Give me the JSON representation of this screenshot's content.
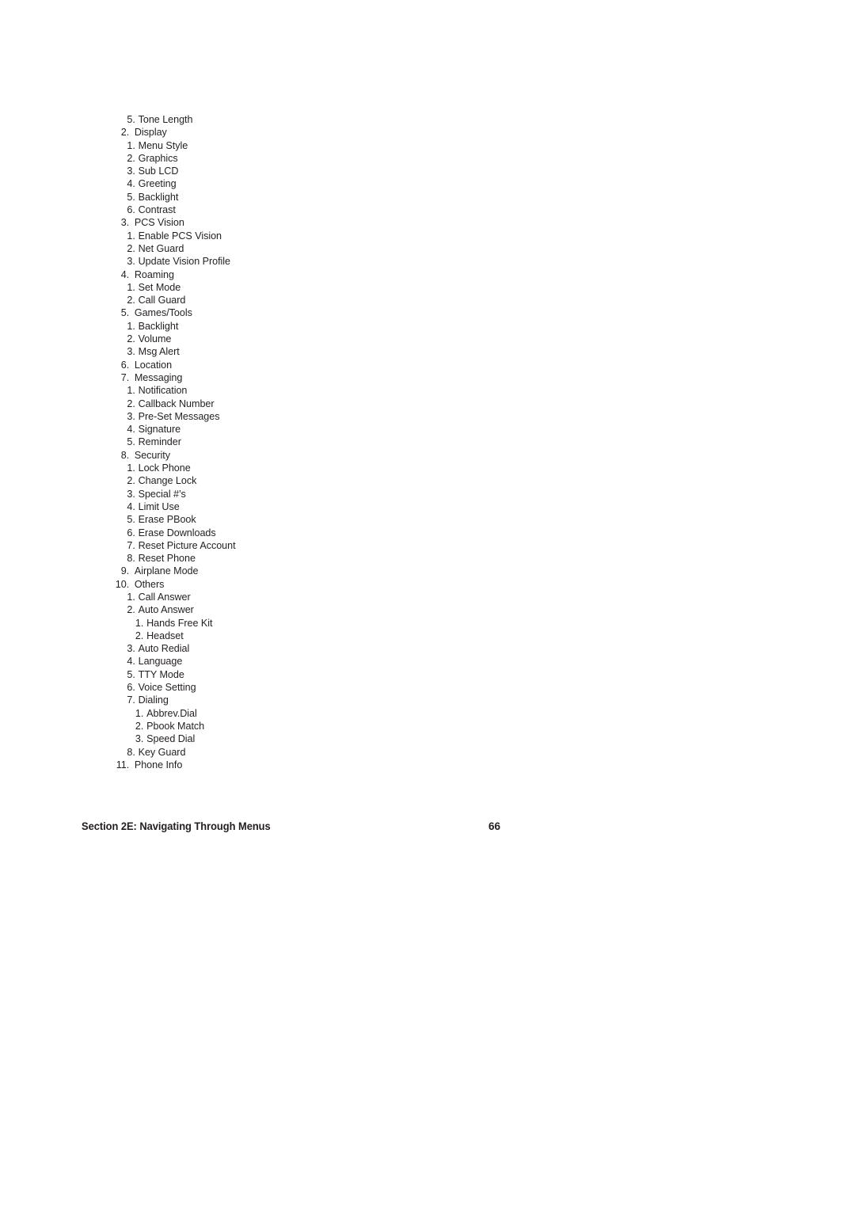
{
  "document": {
    "page_number": "66",
    "footer_title": "Section 2E: Navigating Through Menus"
  },
  "menu_outline": {
    "items": [
      {
        "level": 2,
        "num": "5.",
        "label": "Tone Length"
      },
      {
        "level": 1,
        "num": "2.",
        "label": "Display"
      },
      {
        "level": 2,
        "num": "1.",
        "label": "Menu Style"
      },
      {
        "level": 2,
        "num": "2.",
        "label": "Graphics"
      },
      {
        "level": 2,
        "num": "3.",
        "label": "Sub LCD"
      },
      {
        "level": 2,
        "num": "4.",
        "label": "Greeting"
      },
      {
        "level": 2,
        "num": "5.",
        "label": "Backlight"
      },
      {
        "level": 2,
        "num": "6.",
        "label": "Contrast"
      },
      {
        "level": 1,
        "num": "3.",
        "label": "PCS Vision"
      },
      {
        "level": 2,
        "num": "1.",
        "label": "Enable PCS Vision"
      },
      {
        "level": 2,
        "num": "2.",
        "label": "Net Guard"
      },
      {
        "level": 2,
        "num": "3.",
        "label": "Update Vision Profile"
      },
      {
        "level": 1,
        "num": "4.",
        "label": "Roaming"
      },
      {
        "level": 2,
        "num": "1.",
        "label": "Set Mode"
      },
      {
        "level": 2,
        "num": "2.",
        "label": "Call Guard"
      },
      {
        "level": 1,
        "num": "5.",
        "label": "Games/Tools"
      },
      {
        "level": 2,
        "num": "1.",
        "label": "Backlight"
      },
      {
        "level": 2,
        "num": "2.",
        "label": "Volume"
      },
      {
        "level": 2,
        "num": "3.",
        "label": "Msg Alert"
      },
      {
        "level": 1,
        "num": "6.",
        "label": "Location"
      },
      {
        "level": 1,
        "num": "7.",
        "label": "Messaging"
      },
      {
        "level": 2,
        "num": "1.",
        "label": "Notification"
      },
      {
        "level": 2,
        "num": "2.",
        "label": "Callback Number"
      },
      {
        "level": 2,
        "num": "3.",
        "label": "Pre-Set Messages"
      },
      {
        "level": 2,
        "num": "4.",
        "label": "Signature"
      },
      {
        "level": 2,
        "num": "5.",
        "label": "Reminder"
      },
      {
        "level": 1,
        "num": "8.",
        "label": "Security"
      },
      {
        "level": 2,
        "num": "1.",
        "label": "Lock Phone"
      },
      {
        "level": 2,
        "num": "2.",
        "label": "Change Lock"
      },
      {
        "level": 2,
        "num": "3.",
        "label": "Special #’s"
      },
      {
        "level": 2,
        "num": "4.",
        "label": "Limit Use"
      },
      {
        "level": 2,
        "num": "5.",
        "label": "Erase PBook"
      },
      {
        "level": 2,
        "num": "6.",
        "label": "Erase Downloads"
      },
      {
        "level": 2,
        "num": "7.",
        "label": "Reset Picture Account"
      },
      {
        "level": 2,
        "num": "8.",
        "label": "Reset Phone"
      },
      {
        "level": 1,
        "num": "9.",
        "label": "Airplane Mode"
      },
      {
        "level": 1,
        "num": "10.",
        "label": "Others"
      },
      {
        "level": 2,
        "num": "1.",
        "label": "Call Answer"
      },
      {
        "level": 2,
        "num": "2.",
        "label": "Auto Answer"
      },
      {
        "level": 3,
        "num": "1.",
        "label": "Hands Free Kit"
      },
      {
        "level": 3,
        "num": "2.",
        "label": "Headset"
      },
      {
        "level": 2,
        "num": "3.",
        "label": "Auto Redial"
      },
      {
        "level": 2,
        "num": "4.",
        "label": "Language"
      },
      {
        "level": 2,
        "num": "5.",
        "label": "TTY Mode"
      },
      {
        "level": 2,
        "num": "6.",
        "label": "Voice Setting"
      },
      {
        "level": 2,
        "num": "7.",
        "label": "Dialing"
      },
      {
        "level": 3,
        "num": "1.",
        "label": "Abbrev.Dial"
      },
      {
        "level": 3,
        "num": "2.",
        "label": "Pbook Match"
      },
      {
        "level": 3,
        "num": "3.",
        "label": "Speed Dial"
      },
      {
        "level": 2,
        "num": "8.",
        "label": "Key Guard"
      },
      {
        "level": 1,
        "num": "11.",
        "label": "Phone Info"
      }
    ]
  }
}
